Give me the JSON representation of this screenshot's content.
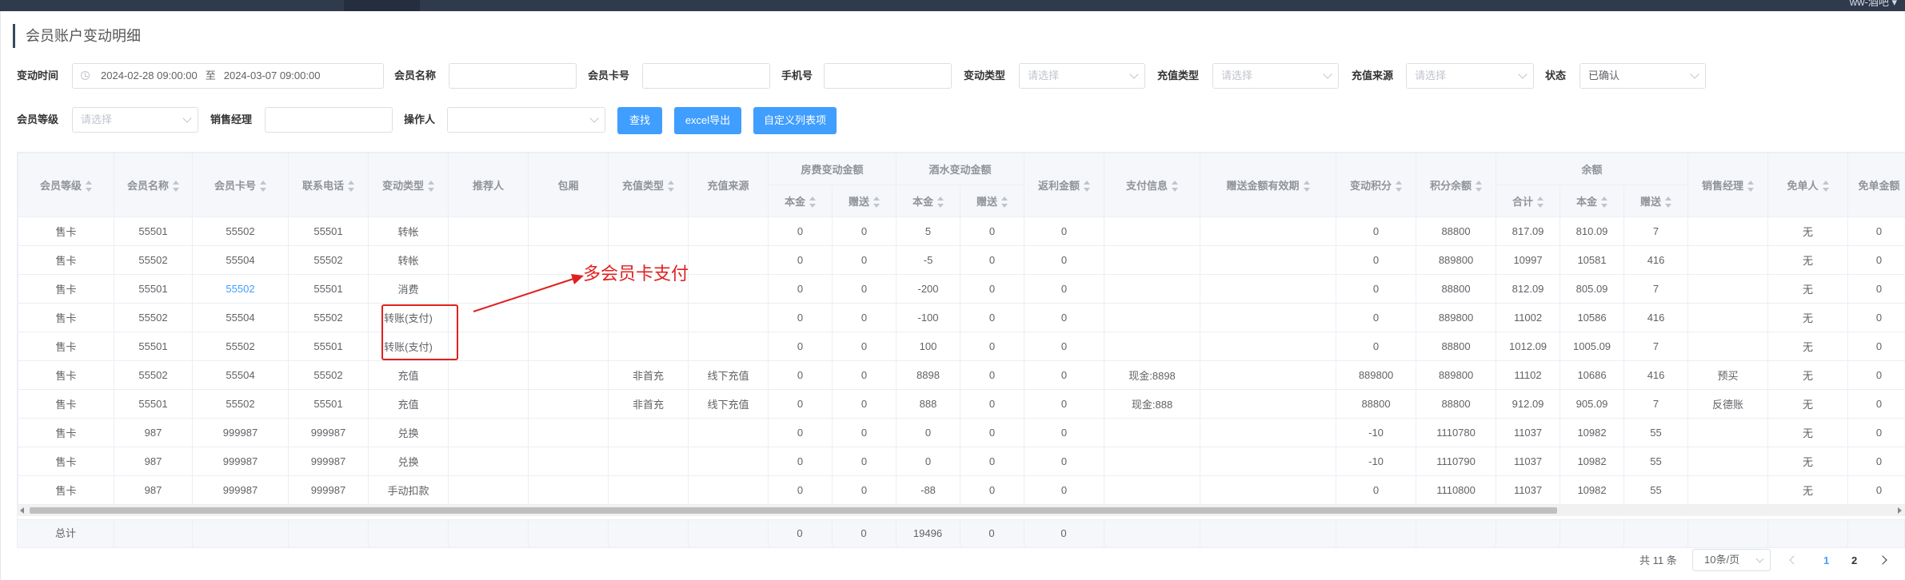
{
  "header": {
    "user_label": "ww-酒吧 ▾"
  },
  "page": {
    "title": "会员账户变动明细"
  },
  "filters": {
    "change_time": {
      "label": "变动时间",
      "start": "2024-02-28 09:00:00",
      "separator": "至",
      "end": "2024-03-07 09:00:00"
    },
    "member_name": {
      "label": "会员名称",
      "value": ""
    },
    "member_card": {
      "label": "会员卡号",
      "value": ""
    },
    "phone": {
      "label": "手机号",
      "value": ""
    },
    "change_type": {
      "label": "变动类型",
      "placeholder": "请选择"
    },
    "recharge_type": {
      "label": "充值类型",
      "placeholder": "请选择"
    },
    "recharge_source": {
      "label": "充值来源",
      "placeholder": "请选择"
    },
    "status": {
      "label": "状态",
      "value": "已确认"
    },
    "member_level": {
      "label": "会员等级",
      "placeholder": "请选择"
    },
    "sales_manager": {
      "label": "销售经理",
      "value": ""
    },
    "operator": {
      "label": "操作人",
      "value": ""
    }
  },
  "buttons": {
    "search": "查找",
    "export": "excel导出",
    "custom_columns": "自定义列表项"
  },
  "table": {
    "headers": {
      "member_level": "会员等级",
      "member_name": "会员名称",
      "member_card": "会员卡号",
      "contact_phone": "联系电话",
      "change_type": "变动类型",
      "referrer": "推荐人",
      "private_room": "包厢",
      "recharge_type": "充值类型",
      "recharge_source": "充值来源",
      "room_change": "房费变动金额",
      "drink_change": "酒水变动金额",
      "principal": "本金",
      "bonus": "赠送",
      "rebate": "返利金额",
      "payment_info": "支付信息",
      "bonus_validity": "赠送金额有效期",
      "points_change": "变动积分",
      "points_balance": "积分余额",
      "balance": "余额",
      "total": "合计",
      "sales_manager": "销售经理",
      "approver": "免单人",
      "free_amount": "免单金额"
    },
    "rows": [
      [
        "售卡",
        "55501",
        "55502",
        "55501",
        "转帐",
        "",
        "",
        "",
        "",
        "0",
        "0",
        "5",
        "0",
        "0",
        "",
        "",
        "0",
        "88800",
        "817.09",
        "810.09",
        "7",
        "",
        "无",
        "0"
      ],
      [
        "售卡",
        "55502",
        "55504",
        "55502",
        "转帐",
        "",
        "",
        "",
        "",
        "0",
        "0",
        "-5",
        "0",
        "0",
        "",
        "",
        "0",
        "889800",
        "10997",
        "10581",
        "416",
        "",
        "无",
        "0"
      ],
      [
        "售卡",
        "55501",
        "55502",
        "55501",
        "消费",
        "",
        "",
        "",
        "",
        "0",
        "0",
        "-200",
        "0",
        "0",
        "",
        "",
        "0",
        "88800",
        "812.09",
        "805.09",
        "7",
        "",
        "无",
        "0"
      ],
      [
        "售卡",
        "55502",
        "55504",
        "55502",
        "转账(支付)",
        "",
        "",
        "",
        "",
        "0",
        "0",
        "-100",
        "0",
        "0",
        "",
        "",
        "0",
        "889800",
        "11002",
        "10586",
        "416",
        "",
        "无",
        "0"
      ],
      [
        "售卡",
        "55501",
        "55502",
        "55501",
        "转账(支付)",
        "",
        "",
        "",
        "",
        "0",
        "0",
        "100",
        "0",
        "0",
        "",
        "",
        "0",
        "88800",
        "1012.09",
        "1005.09",
        "7",
        "",
        "无",
        "0"
      ],
      [
        "售卡",
        "55502",
        "55504",
        "55502",
        "充值",
        "",
        "",
        "非首充",
        "线下充值",
        "0",
        "0",
        "8898",
        "0",
        "0",
        "现金:8898",
        "",
        "889800",
        "889800",
        "11102",
        "10686",
        "416",
        "预买",
        "无",
        "0"
      ],
      [
        "售卡",
        "55501",
        "55502",
        "55501",
        "充值",
        "",
        "",
        "非首充",
        "线下充值",
        "0",
        "0",
        "888",
        "0",
        "0",
        "现金:888",
        "",
        "88800",
        "88800",
        "912.09",
        "905.09",
        "7",
        "反德账",
        "无",
        "0"
      ],
      [
        "售卡",
        "987",
        "999987",
        "999987",
        "兑换",
        "",
        "",
        "",
        "",
        "0",
        "0",
        "0",
        "0",
        "0",
        "",
        "",
        "-10",
        "1110780",
        "11037",
        "10982",
        "55",
        "",
        "无",
        "0"
      ],
      [
        "售卡",
        "987",
        "999987",
        "999987",
        "兑换",
        "",
        "",
        "",
        "",
        "0",
        "0",
        "0",
        "0",
        "0",
        "",
        "",
        "-10",
        "1110790",
        "11037",
        "10982",
        "55",
        "",
        "无",
        "0"
      ],
      [
        "售卡",
        "987",
        "999987",
        "999987",
        "手动扣款",
        "",
        "",
        "",
        "",
        "0",
        "0",
        "-88",
        "0",
        "0",
        "",
        "",
        "0",
        "1110800",
        "11037",
        "10982",
        "55",
        "",
        "无",
        "0"
      ]
    ],
    "summary": {
      "label": "总计",
      "room_principal": "0",
      "room_bonus": "0",
      "drink_principal": "19496",
      "drink_bonus": "0",
      "rebate": "0"
    }
  },
  "annotation": {
    "text": "多会员卡支付",
    "color": "#e02020"
  },
  "pagination": {
    "total_text": "共 11 条",
    "page_size": "10条/页",
    "pages": [
      "1",
      "2"
    ],
    "current": "1"
  },
  "colors": {
    "primary": "#409eff",
    "header_bar": "#2f3a4d",
    "annotation": "#e02020"
  }
}
